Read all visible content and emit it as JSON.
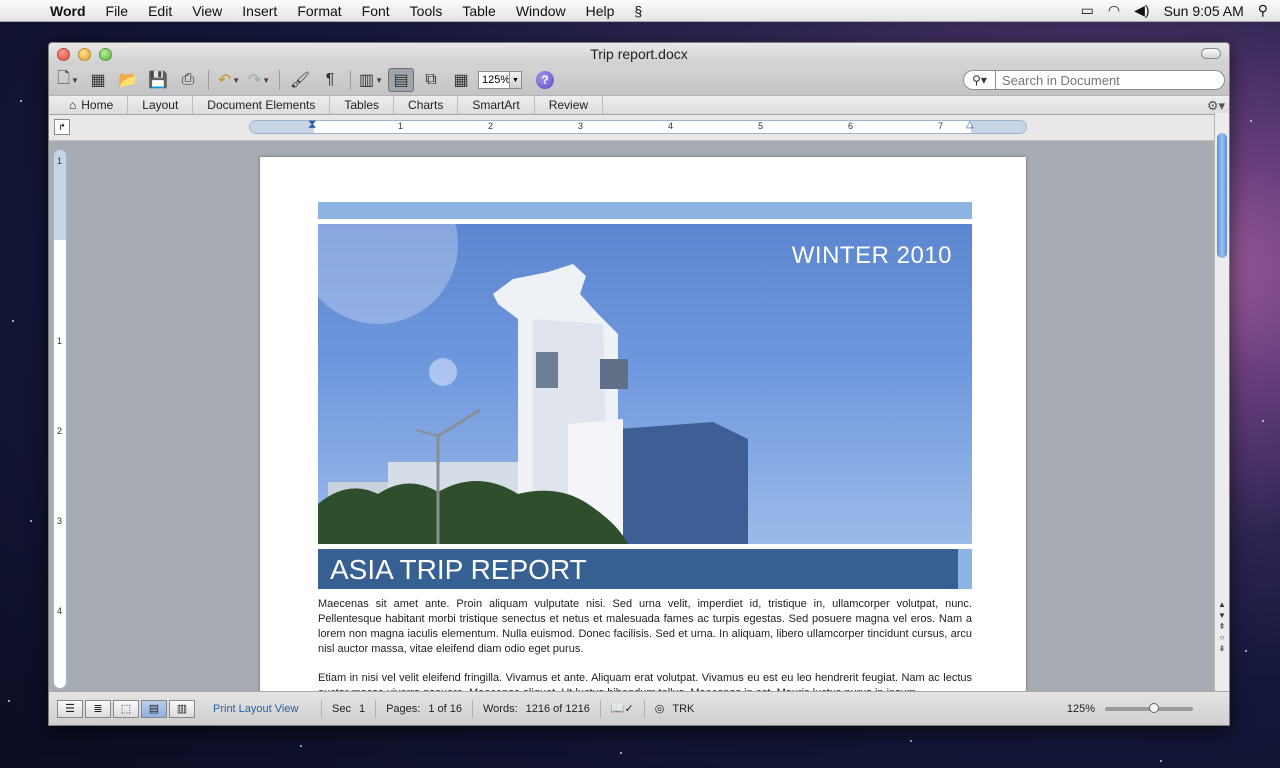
{
  "menubar": {
    "app": "Word",
    "items": [
      "File",
      "Edit",
      "View",
      "Insert",
      "Format",
      "Font",
      "Tools",
      "Table",
      "Window",
      "Help"
    ],
    "clock": "Sun 9:05 AM"
  },
  "window": {
    "title": "Trip report.docx"
  },
  "toolbar": {
    "zoom": "125%",
    "search_placeholder": "Search in Document"
  },
  "ribbon": {
    "tabs": [
      "Home",
      "Layout",
      "Document Elements",
      "Tables",
      "Charts",
      "SmartArt",
      "Review"
    ]
  },
  "ruler": {
    "numbers": [
      "1",
      "2",
      "3",
      "4",
      "5",
      "6",
      "7"
    ],
    "vnumbers": [
      "1",
      "1",
      "2",
      "3",
      "4"
    ]
  },
  "document": {
    "season": "WINTER 2010",
    "title": "ASIA TRIP REPORT",
    "paragraph1": "Maecenas sit amet ante. Proin aliquam vulputate nisi. Sed urna velit, imperdiet id, tristique in, ullamcorper volutpat, nunc. Pellentesque habitant morbi tristique senectus et netus et malesuada fames ac turpis egestas. Sed posuere magna vel eros. Nam a lorem non magna iaculis elementum. Nulla euismod. Donec facilisis. Sed et urna. In aliquam, libero ullamcorper tincidunt cursus, arcu nisl auctor massa, vitae eleifend diam odio eget purus.",
    "paragraph2": "Etiam in nisi vel velit eleifend fringilla.  Vivamus et ante. Aliquam erat volutpat. Vivamus eu est eu leo hendrerit feugiat. Nam ac lectus auctor massa viverra posuere. Maecenas aliquet. Ut luctus bibendum tellus. Maecenas in est. Mauris luctus purus in ipsum."
  },
  "statusbar": {
    "view_name": "Print Layout View",
    "sec_label": "Sec",
    "sec_value": "1",
    "pages_label": "Pages:",
    "pages_value": "1 of 16",
    "words_label": "Words:",
    "words_value": "1216 of 1216",
    "trk": "TRK",
    "zoom": "125%"
  }
}
